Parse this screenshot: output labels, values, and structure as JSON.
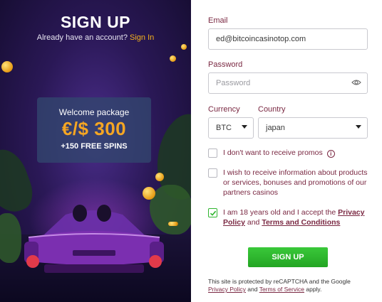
{
  "promo": {
    "title": "SIGN UP",
    "have_account_text": "Already have an account?",
    "signin_link": "Sign In",
    "welcome_label": "Welcome package",
    "welcome_amount": "€/$ 300",
    "welcome_spins": "+150 FREE SPINS"
  },
  "form": {
    "email_label": "Email",
    "email_value": "ed@bitcoincasinotop.com",
    "password_label": "Password",
    "password_placeholder": "Password",
    "currency_label": "Currency",
    "currency_value": "BTC",
    "country_label": "Country",
    "country_value": "japan",
    "promos_text": "I don't want to receive promos",
    "info_text": "I wish to receive information about products or services, bonuses and promotions of our partners casinos",
    "age_text_prefix": "I am 18 years old and I accept the",
    "privacy_policy_link": "Privacy Policy",
    "and_text": "and",
    "terms_link": "Terms and Conditions",
    "submit_label": "SIGN UP",
    "recaptcha_text_prefix": "This site is protected by reCAPTCHA and the Google",
    "recaptcha_privacy_link": "Privacy Policy",
    "recaptcha_and": "and",
    "recaptcha_terms_link": "Terms of Service",
    "recaptcha_suffix": "apply.",
    "checkbox_states": {
      "no_promos": false,
      "partner_info": false,
      "age_terms": true
    }
  },
  "icons": [
    "eye-icon",
    "chevron-down-icon",
    "info-icon",
    "checkmark-icon"
  ],
  "colors": {
    "accent": "#7a2842",
    "signin": "#f5b21c",
    "amount": "#f5a623",
    "button": "#2fb52f"
  }
}
